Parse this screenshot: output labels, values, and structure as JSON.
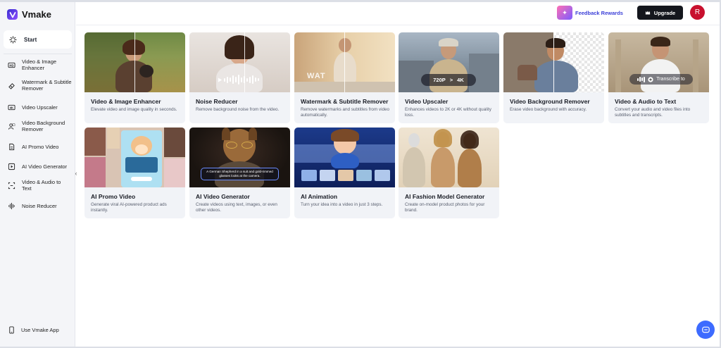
{
  "app": {
    "name": "Vmake"
  },
  "sidebar": {
    "start": {
      "label": "Start",
      "icon": "sparkle-icon"
    },
    "items": [
      {
        "label": "Video & Image Enhancer",
        "icon": "hd-icon"
      },
      {
        "label": "Watermark & Subtitle Remover",
        "icon": "eraser-icon"
      },
      {
        "label": "Video Upscaler",
        "icon": "4k-icon"
      },
      {
        "label": "Video Background Remover",
        "icon": "person-cutout-icon"
      },
      {
        "label": "AI Promo Video",
        "icon": "document-icon"
      },
      {
        "label": "AI Video Generator",
        "icon": "play-square-icon"
      },
      {
        "label": "Video & Audio to Text",
        "icon": "transcribe-icon"
      },
      {
        "label": "Noise Reducer",
        "icon": "waveform-icon"
      }
    ],
    "use_app": {
      "label": "Use Vmake App",
      "icon": "phone-icon"
    }
  },
  "header": {
    "feedback_label": "Feedback Rewards",
    "upgrade_label": "Upgrade",
    "avatar_initial": "R"
  },
  "cards": [
    {
      "title": "Video & Image Enhancer",
      "desc": "Elevate video and image quality in seconds."
    },
    {
      "title": "Noise Reducer",
      "desc": "Remove background noise from the video."
    },
    {
      "title": "Watermark & Subtitle Remover",
      "desc": "Remove watermarks and subtitles from video automatically.",
      "overlay": "WAT"
    },
    {
      "title": "Video Upscaler",
      "desc": "Enhances videos to 2K or 4K without quality loss.",
      "badge_from": "720P",
      "badge_arrow": ">",
      "badge_to": "4K"
    },
    {
      "title": "Video Background Remover",
      "desc": "Erase video background with accuracy."
    },
    {
      "title": "Video & Audio to Text",
      "desc": "Convert your audio and video files into subtitles and transcripts.",
      "pill": "Transcribe to"
    },
    {
      "title": "AI Promo Video",
      "desc": "Generate viral AI-powered product ads instantly."
    },
    {
      "title": "AI Video Generator",
      "desc": "Create videos using text, images, or even other videos.",
      "prompt": "A German Shepherd in a suit and gold-rimmed glasses looks at the camera."
    },
    {
      "title": "AI Animation",
      "desc": "Turn your idea into a video in just 3 steps."
    },
    {
      "title": "AI Fashion Model Generator",
      "desc": "Create on-model product photos for your brand."
    }
  ],
  "colors": {
    "accent": "#3d6bff",
    "upgrade_bg": "#14161d",
    "avatar_bg": "#c8102e",
    "feedback_text": "#3b3fd8"
  }
}
